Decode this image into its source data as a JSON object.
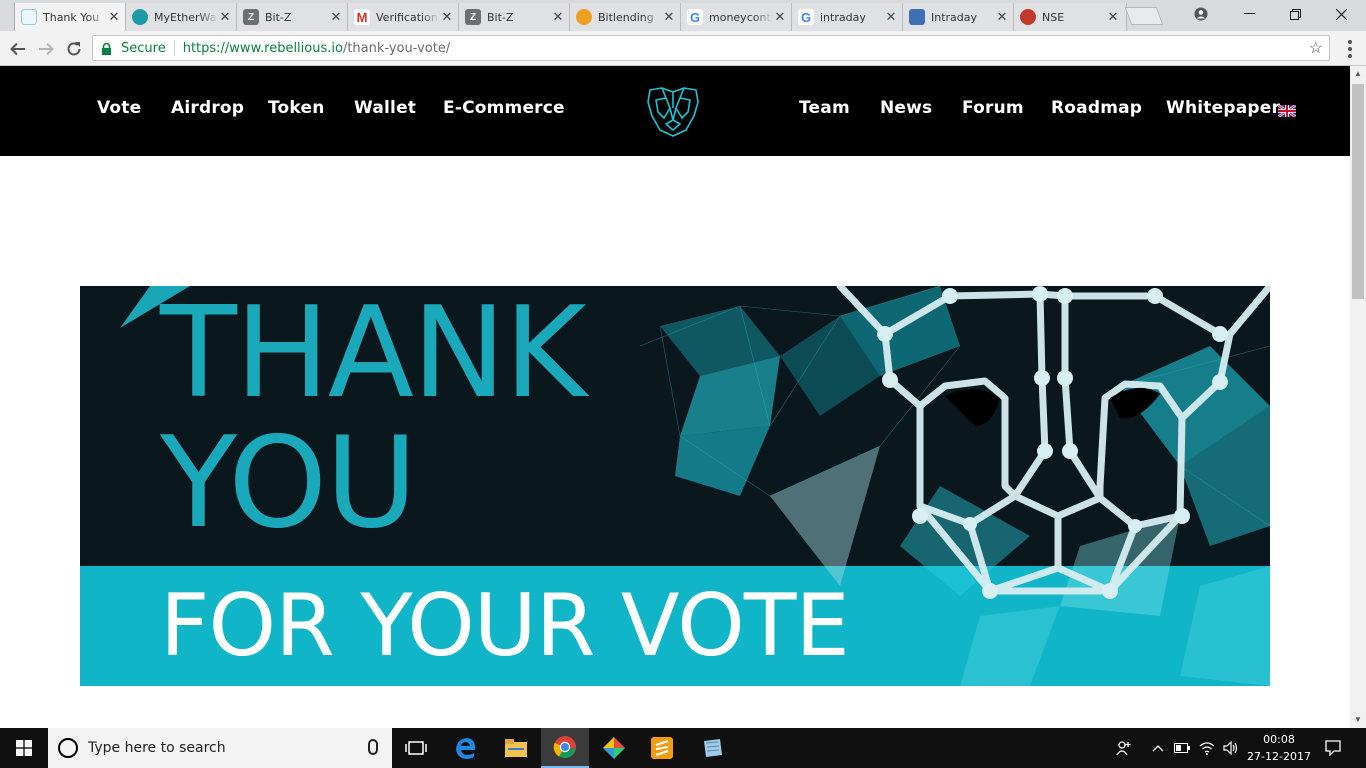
{
  "browser": {
    "tabs": [
      {
        "title": "Thank You",
        "icon": "rebellious-favicon",
        "active": true
      },
      {
        "title": "MyEtherWallet",
        "icon": "myetherwallet-favicon"
      },
      {
        "title": "Bit-Z",
        "icon": "bitz-favicon"
      },
      {
        "title": "Verification",
        "icon": "gmail-favicon"
      },
      {
        "title": "Bit-Z",
        "icon": "bitz-favicon"
      },
      {
        "title": "Bitlending",
        "icon": "bitlending-favicon"
      },
      {
        "title": "moneycontrol",
        "icon": "google-favicon"
      },
      {
        "title": "intraday",
        "icon": "google-favicon"
      },
      {
        "title": "Intraday",
        "icon": "chart-favicon"
      },
      {
        "title": "NSE",
        "icon": "nse-favicon"
      }
    ],
    "secure_label": "Secure",
    "url_host": "https://www.rebellious.io",
    "url_path": "/thank-you-vote/"
  },
  "site": {
    "nav_left": [
      "Vote",
      "Airdrop",
      "Token",
      "Wallet",
      "E-Commerce"
    ],
    "nav_right": [
      "Team",
      "News",
      "Forum",
      "Roadmap",
      "Whitepaper"
    ],
    "language_flag": "uk-flag-icon"
  },
  "banner": {
    "line1": "THANK",
    "line2": "YOU",
    "line3": "FOR YOUR VOTE",
    "colors": {
      "dark": "#0b1a1f",
      "teal": "#0fb3c6",
      "heading": "#1aa9bb",
      "light_text": "#ffffff"
    }
  },
  "taskbar": {
    "search_placeholder": "Type here to search",
    "time": "00:08",
    "date": "27-12-2017"
  }
}
